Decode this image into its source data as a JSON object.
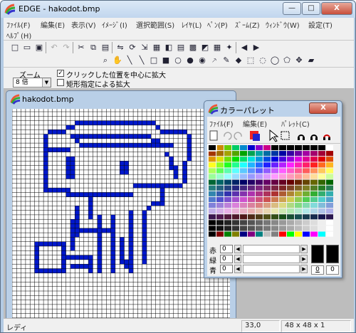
{
  "window": {
    "title": "EDGE - hakodot.bmp",
    "minimize": "—",
    "maximize": "□",
    "close": "X"
  },
  "menu": [
    "ﾌｧｲﾙ(F)",
    "編集(E)",
    "表示(V)",
    "ｲﾒｰｼﾞ(I)",
    "選択範囲(S)",
    "ﾚｲﾔ(L)",
    "ﾍﾟﾝ(P)",
    "ｽﾞｰﾑ(Z)",
    "ｳｨﾝﾄﾞｳ(W)",
    "設定(T)",
    "ﾍﾙﾌﾟ(H)"
  ],
  "zoom": {
    "label": "ズーム",
    "value": "8 倍",
    "arrow": "▼"
  },
  "options": {
    "center_click": {
      "label": "クリックした位置を中心に拡大",
      "checked": true,
      "mark": "✓"
    },
    "rect_zoom": {
      "label": "矩形指定による拡大",
      "checked": false
    }
  },
  "toolbar_icons": [
    "new-file-icon",
    "open-folder-icon",
    "save-icon",
    "undo-icon",
    "redo-icon",
    "cut-icon",
    "copy-icon",
    "paste-icon",
    "flip-icon",
    "rotate-icon",
    "resize-icon",
    "grid-icon",
    "palette-icon",
    "layer-icon",
    "image-icon",
    "color-swap-icon",
    "pattern-icon",
    "effect-icon",
    "arrow-left-icon",
    "arrow-right-icon",
    "magnifier-icon",
    "hand-icon",
    "pen-icon",
    "line-icon",
    "rect-icon",
    "filled-rect-icon",
    "ellipse-icon",
    "filled-ellipse-icon",
    "fill-icon",
    "dropper-icon",
    "brush-icon",
    "eraser-icon",
    "select-rect-icon",
    "select-ellipse-icon",
    "lasso-icon",
    "polygon-select-icon",
    "move-icon",
    "text-icon"
  ],
  "document": {
    "title": "hakodot.bmp"
  },
  "palette": {
    "title": "カラーパレット",
    "close": "X",
    "menu": [
      "ﾌｧｲﾙ(F)",
      "編集(E)",
      "ﾊﾟﾚｯﾄ(C)"
    ],
    "rgb": [
      {
        "label": "赤",
        "value": "0"
      },
      {
        "label": "緑",
        "value": "0"
      },
      {
        "label": "青",
        "value": "0"
      }
    ],
    "fg_index": "0",
    "bg_index": "0",
    "arrow_left": "◀",
    "arrow_right": "▶"
  },
  "status": {
    "mode": "レディ",
    "coords": "33,0",
    "size": "48 x 48 x 1"
  },
  "colors": {
    "pixel": "#0018cc",
    "accent": "#b9cfe7"
  }
}
